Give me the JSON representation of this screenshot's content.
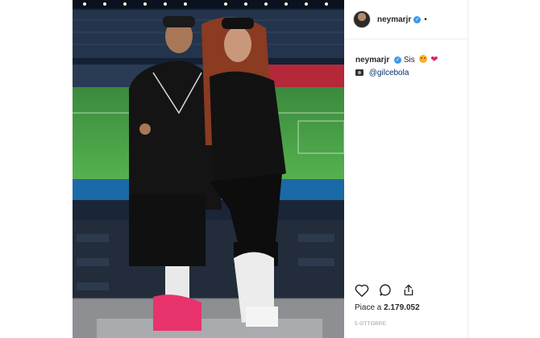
{
  "post": {
    "username": "neymarjr",
    "verified_glyph": "✓",
    "more_glyph": "•"
  },
  "caption": {
    "username": "neymarjr",
    "text": "Sis",
    "emoji": [
      "heart-eyes-icon",
      "red-heart-icon"
    ],
    "photo_credit_icon": "camera-icon",
    "mention": "@gilcebola"
  },
  "actions": {
    "icons": [
      "heart-icon",
      "comment-icon",
      "share-icon"
    ]
  },
  "likes": {
    "prefix": "Piace a",
    "count": "2.179.052"
  },
  "date": "5 OTTOBRE",
  "colors": {
    "accent_blue": "#3897f0",
    "text": "#262626",
    "muted": "#999999",
    "stadium_grass": "#3d9b3f",
    "shoes_pink": "#e8336d"
  }
}
